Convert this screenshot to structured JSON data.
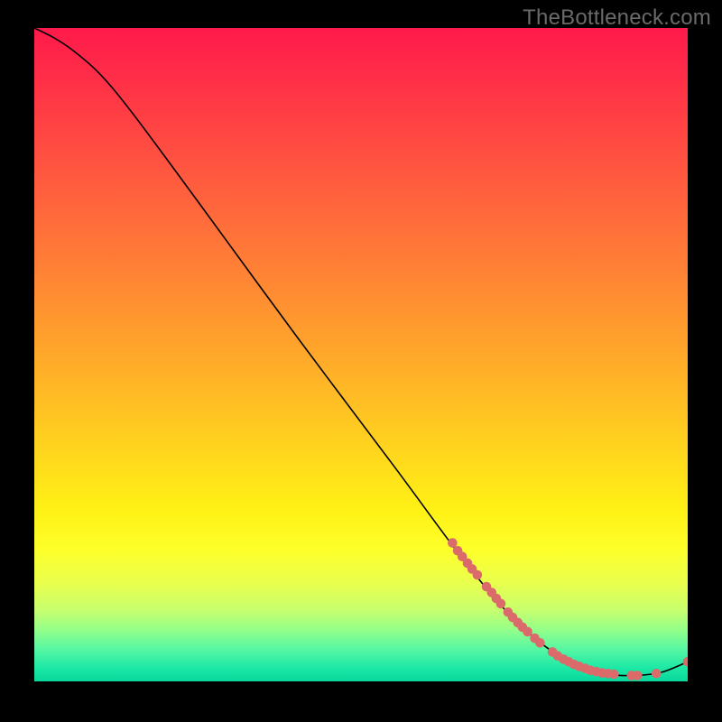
{
  "attribution": "TheBottleneck.com",
  "colors": {
    "page_bg": "#000000",
    "dot": "#db6b6b",
    "curve": "#000000",
    "attribution_text": "#6a6a6a"
  },
  "chart_data": {
    "type": "line",
    "title": "",
    "xlabel": "",
    "ylabel": "",
    "xlim": [
      0,
      100
    ],
    "ylim": [
      0,
      100
    ],
    "grid": false,
    "legend": false,
    "curve": [
      {
        "x": 0,
        "y": 100
      },
      {
        "x": 3,
        "y": 98.5
      },
      {
        "x": 6,
        "y": 96.5
      },
      {
        "x": 10,
        "y": 93
      },
      {
        "x": 15,
        "y": 87
      },
      {
        "x": 25,
        "y": 73.5
      },
      {
        "x": 40,
        "y": 53
      },
      {
        "x": 55,
        "y": 33
      },
      {
        "x": 65,
        "y": 19.5
      },
      {
        "x": 72,
        "y": 11
      },
      {
        "x": 78,
        "y": 5.5
      },
      {
        "x": 83,
        "y": 2.5
      },
      {
        "x": 88,
        "y": 1.1
      },
      {
        "x": 92,
        "y": 0.9
      },
      {
        "x": 96,
        "y": 1.4
      },
      {
        "x": 100,
        "y": 3.0
      }
    ],
    "highlight_points": [
      {
        "x": 64.0,
        "y": 21.2
      },
      {
        "x": 64.8,
        "y": 20.0
      },
      {
        "x": 65.5,
        "y": 19.1
      },
      {
        "x": 66.3,
        "y": 18.1
      },
      {
        "x": 67.0,
        "y": 17.2
      },
      {
        "x": 67.8,
        "y": 16.3
      },
      {
        "x": 69.2,
        "y": 14.5
      },
      {
        "x": 70.0,
        "y": 13.6
      },
      {
        "x": 70.7,
        "y": 12.7
      },
      {
        "x": 71.4,
        "y": 11.9
      },
      {
        "x": 72.5,
        "y": 10.6
      },
      {
        "x": 73.2,
        "y": 9.8
      },
      {
        "x": 74.0,
        "y": 9.0
      },
      {
        "x": 74.7,
        "y": 8.3
      },
      {
        "x": 75.5,
        "y": 7.6
      },
      {
        "x": 76.6,
        "y": 6.6
      },
      {
        "x": 77.4,
        "y": 5.9
      },
      {
        "x": 79.3,
        "y": 4.5
      },
      {
        "x": 80.1,
        "y": 3.9
      },
      {
        "x": 81.0,
        "y": 3.4
      },
      {
        "x": 81.8,
        "y": 3.0
      },
      {
        "x": 82.6,
        "y": 2.6
      },
      {
        "x": 83.4,
        "y": 2.3
      },
      {
        "x": 84.3,
        "y": 2.0
      },
      {
        "x": 85.1,
        "y": 1.7
      },
      {
        "x": 86.0,
        "y": 1.5
      },
      {
        "x": 86.9,
        "y": 1.3
      },
      {
        "x": 87.8,
        "y": 1.2
      },
      {
        "x": 88.7,
        "y": 1.1
      },
      {
        "x": 91.4,
        "y": 0.9
      },
      {
        "x": 92.3,
        "y": 0.9
      },
      {
        "x": 95.2,
        "y": 1.2
      },
      {
        "x": 100.0,
        "y": 3.0
      }
    ]
  }
}
